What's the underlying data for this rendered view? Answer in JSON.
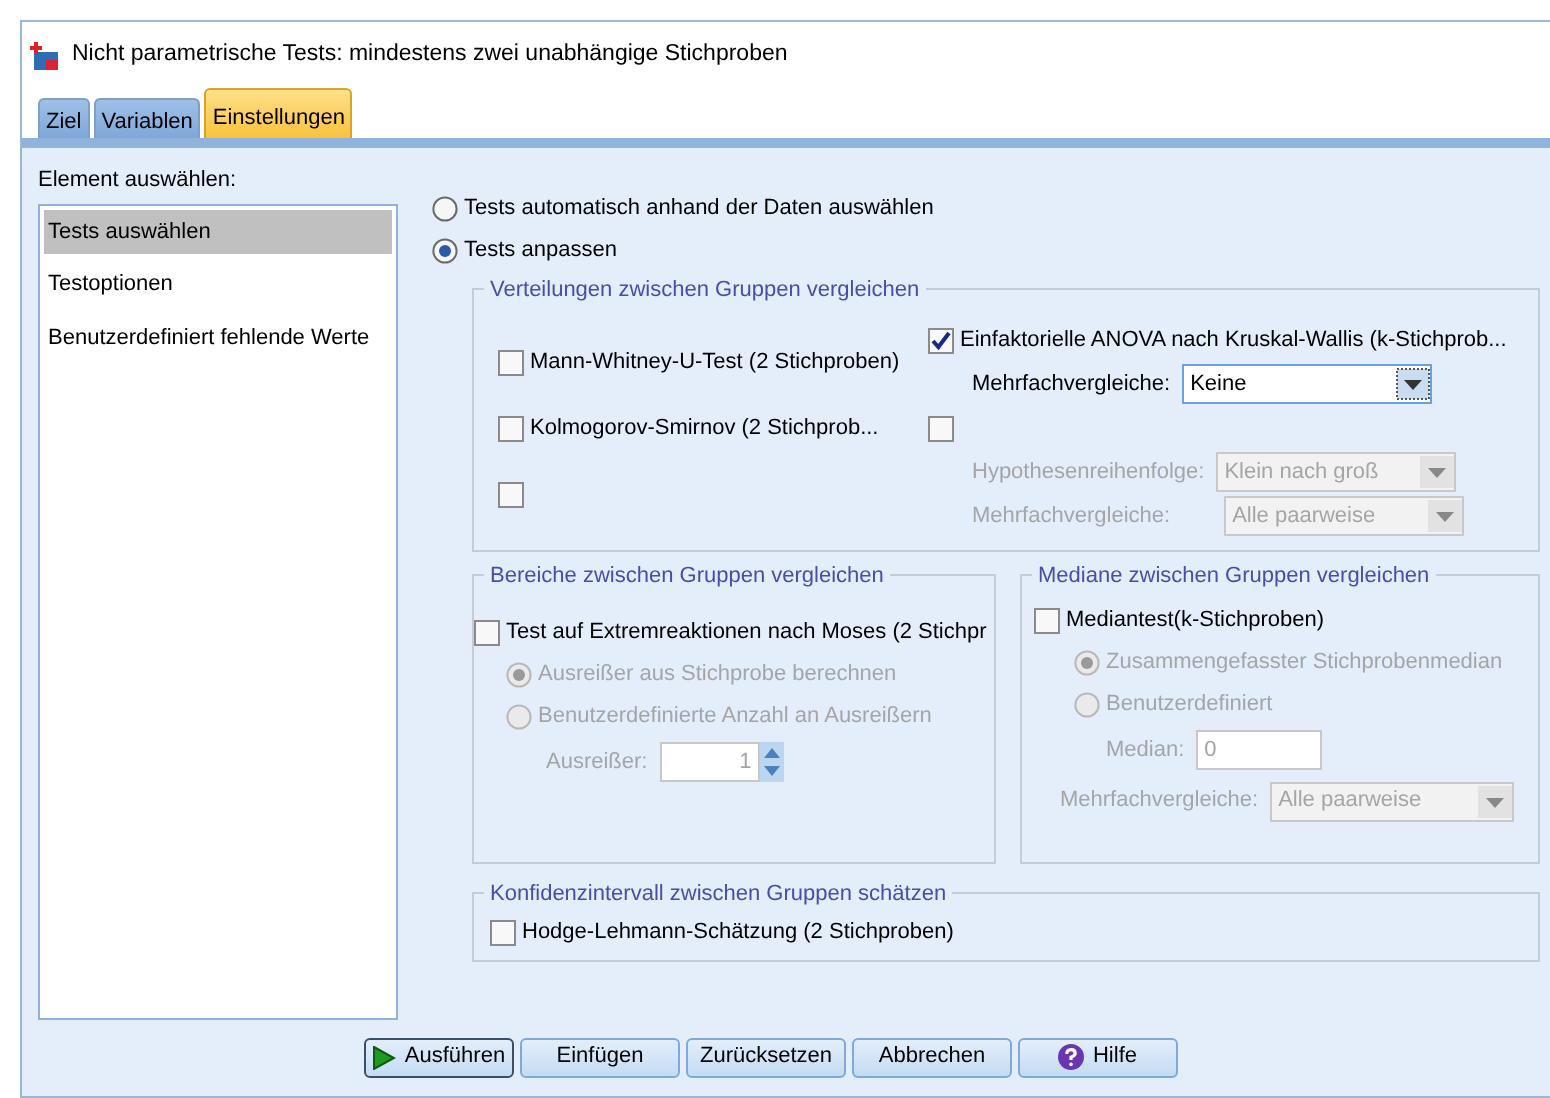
{
  "window": {
    "title": "Nicht parametrische Tests: mindestens zwei unabhängige Stichproben"
  },
  "tabs": [
    {
      "label": "Ziel",
      "selected": false
    },
    {
      "label": "Variablen",
      "selected": false
    },
    {
      "label": "Einstellungen",
      "selected": true
    }
  ],
  "sidebar": {
    "label": "Element auswählen:",
    "items": [
      {
        "label": "Tests auswählen",
        "selected": true
      },
      {
        "label": "Testoptionen",
        "selected": false
      },
      {
        "label": "Benutzerdefiniert fehlende Werte",
        "selected": false
      }
    ]
  },
  "mode_options": [
    {
      "label": "Tests automatisch anhand der Daten auswählen",
      "selected": false
    },
    {
      "label": "Tests anpassen",
      "selected": true
    }
  ],
  "distributions": {
    "title": "Verteilungen zwischen Gruppen vergleichen",
    "mann_whitney": {
      "label": "Mann-Whitney-U-Test (2 Stichproben)",
      "checked": false
    },
    "kolmogorov": {
      "label": "Kolmogorov-Smirnov (2 Stichprob...",
      "checked": false
    },
    "unlabeled": {
      "checked": false
    },
    "kruskal_wallis": {
      "label": "Einfaktorielle ANOVA nach Kruskal-Wallis (k-Stichprob...",
      "checked": true
    },
    "kruskal_comparisons": {
      "label": "Mehrfachvergleiche:",
      "value": "Keine",
      "disabled": false
    },
    "ordered": {
      "checked": false
    },
    "hypothesis_order": {
      "label": "Hypothesenreihenfolge:",
      "value": "Klein nach groß",
      "disabled": true
    },
    "ordered_comparisons": {
      "label": "Mehrfachvergleiche:",
      "value": "Alle paarweise",
      "disabled": true
    }
  },
  "ranges": {
    "title": "Bereiche zwischen Gruppen vergleichen",
    "moses": {
      "label": "Test auf Extremreaktionen nach Moses (2 Stichpr",
      "checked": false
    },
    "options": [
      {
        "label": "Ausreißer aus Stichprobe berechnen",
        "selected": true,
        "disabled": true
      },
      {
        "label": "Benutzerdefinierte Anzahl an Ausreißern",
        "selected": false,
        "disabled": true
      }
    ],
    "outliers": {
      "label": "Ausreißer:",
      "value": "1",
      "disabled": true
    }
  },
  "medians": {
    "title": "Mediane zwischen Gruppen vergleichen",
    "median_test": {
      "label": "Mediantest(k-Stichproben)",
      "checked": false
    },
    "options": [
      {
        "label": "Zusammengefasster Stichprobenmedian",
        "selected": true,
        "disabled": true
      },
      {
        "label": "Benutzerdefiniert",
        "selected": false,
        "disabled": true
      }
    ],
    "median": {
      "label": "Median:",
      "value": "0",
      "disabled": true
    },
    "comparisons": {
      "label": "Mehrfachvergleiche:",
      "value": "Alle paarweise",
      "disabled": true
    }
  },
  "confidence": {
    "title": "Konfidenzintervall zwischen Gruppen schätzen",
    "hodges_lehmann": {
      "label": "Hodge-Lehmann-Schätzung (2 Stichproben)",
      "checked": false
    }
  },
  "buttons": [
    {
      "label": "Ausführen",
      "kind": "run",
      "default": true
    },
    {
      "label": "Einfügen",
      "kind": "plain",
      "default": false
    },
    {
      "label": "Zurücksetzen",
      "kind": "plain",
      "default": false
    },
    {
      "label": "Abbrechen",
      "kind": "plain",
      "default": false
    },
    {
      "label": "Hilfe",
      "kind": "help",
      "default": false
    }
  ]
}
